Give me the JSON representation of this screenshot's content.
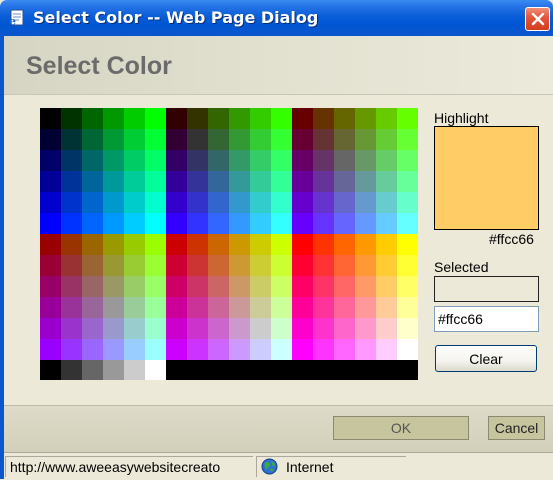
{
  "window": {
    "title": "Select Color -- Web Page Dialog",
    "icon": "ie-document-icon"
  },
  "dialog": {
    "heading": "Select Color"
  },
  "highlight": {
    "label": "Highlight",
    "hex": "#ffcc66",
    "color": "#ffcc66"
  },
  "selected": {
    "label": "Selected",
    "swatch_color": "#ece9d8",
    "value": "#ffcc66"
  },
  "buttons": {
    "clear": "Clear",
    "ok": "OK",
    "cancel": "Cancel"
  },
  "statusbar": {
    "url": "http://www.aweeasywebsitecreato",
    "zone": "Internet",
    "zone_icon": "globe-icon"
  },
  "palette": {
    "type": "web-safe-216",
    "levels": [
      "00",
      "33",
      "66",
      "99",
      "cc",
      "ff"
    ],
    "grayscale_row": [
      "#000000",
      "#333333",
      "#666666",
      "#999999",
      "#cccccc",
      "#ffffff"
    ],
    "black_bar": "#000000"
  }
}
